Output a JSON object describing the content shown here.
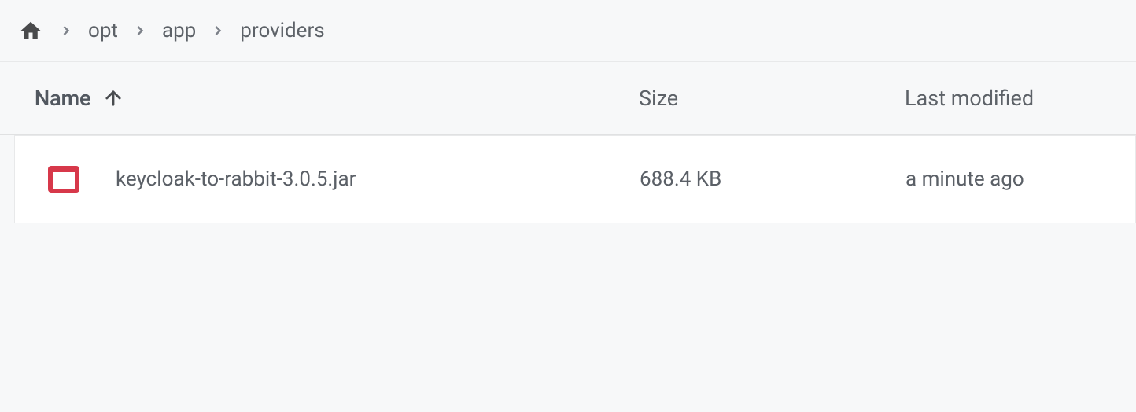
{
  "breadcrumb": {
    "items": [
      "opt",
      "app",
      "providers"
    ]
  },
  "columns": {
    "name": "Name",
    "size": "Size",
    "modified": "Last modified"
  },
  "files": [
    {
      "name": "keycloak-to-rabbit-3.0.5.jar",
      "size": "688.4 KB",
      "modified": "a minute ago"
    }
  ]
}
